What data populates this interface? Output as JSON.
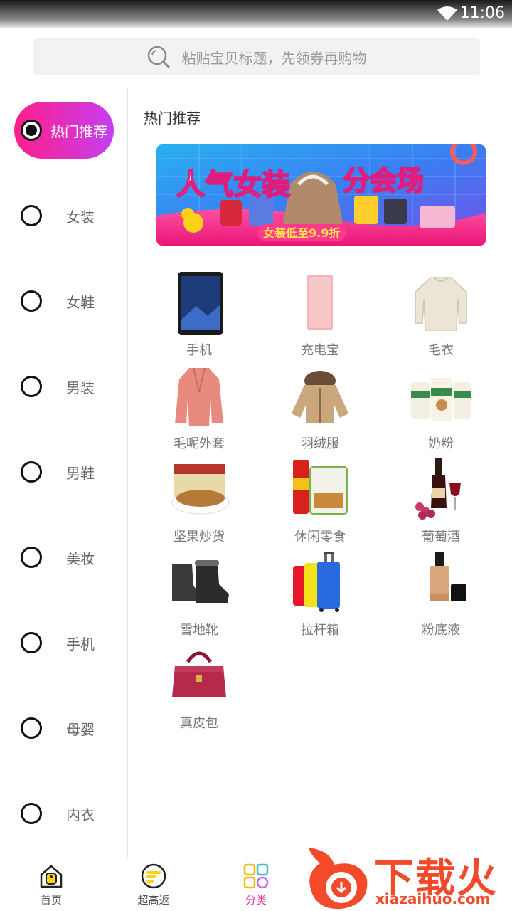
{
  "status_bar": {
    "time": "11:06"
  },
  "search": {
    "placeholder": "粘贴宝贝标题，先领券再购物"
  },
  "sidebar": {
    "items": [
      {
        "label": "热门推荐",
        "active": true
      },
      {
        "label": "女装"
      },
      {
        "label": "女鞋"
      },
      {
        "label": "男装"
      },
      {
        "label": "男鞋"
      },
      {
        "label": "美妆"
      },
      {
        "label": "手机"
      },
      {
        "label": "母婴"
      },
      {
        "label": "内衣"
      }
    ]
  },
  "main": {
    "section_title": "热门推荐",
    "banner": {
      "headline": "人气女装",
      "headline2": "分会场",
      "sub": "女装低至9.9折"
    },
    "items": [
      {
        "label": "手机",
        "icon": "phone-icon"
      },
      {
        "label": "充电宝",
        "icon": "power-bank-icon"
      },
      {
        "label": "毛衣",
        "icon": "sweater-icon"
      },
      {
        "label": "毛呢外套",
        "icon": "wool-coat-icon"
      },
      {
        "label": "羽绒服",
        "icon": "down-jacket-icon"
      },
      {
        "label": "奶粉",
        "icon": "milk-powder-icon"
      },
      {
        "label": "坚果炒货",
        "icon": "nuts-icon"
      },
      {
        "label": "休闲零食",
        "icon": "snacks-icon"
      },
      {
        "label": "葡萄酒",
        "icon": "wine-icon"
      },
      {
        "label": "雪地靴",
        "icon": "snow-boots-icon"
      },
      {
        "label": "拉杆箱",
        "icon": "luggage-icon"
      },
      {
        "label": "粉底液",
        "icon": "foundation-icon"
      },
      {
        "label": "真皮包",
        "icon": "leather-bag-icon"
      }
    ]
  },
  "tabbar": {
    "tabs": [
      {
        "label": "首页",
        "icon": "home-icon"
      },
      {
        "label": "超高返",
        "icon": "rebate-icon"
      },
      {
        "label": "分类",
        "icon": "category-icon",
        "active": true
      }
    ]
  },
  "watermark": {
    "title": "下载火",
    "url": "xiazaihuo.com"
  },
  "colors": {
    "accent": "#e4389a",
    "gradient_start": "#ff1f8a",
    "gradient_end": "#c43ff0",
    "watermark": "#f24a2a"
  }
}
